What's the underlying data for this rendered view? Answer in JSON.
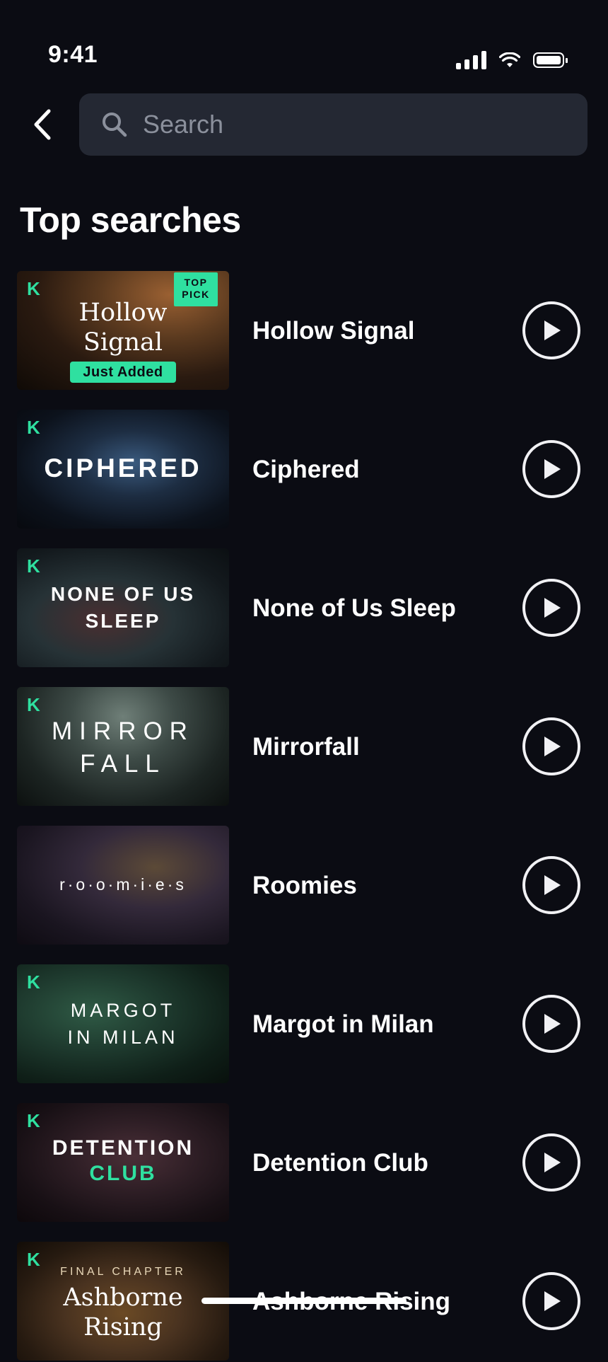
{
  "status_bar": {
    "time": "9:41",
    "icons": [
      "cellular-signal-icon",
      "wifi-icon",
      "battery-icon"
    ]
  },
  "header": {
    "back_icon": "chevron-left-icon",
    "search": {
      "placeholder": "Search",
      "value": "",
      "icon": "search-icon"
    }
  },
  "section": {
    "title": "Top searches"
  },
  "badges": {
    "k": "K",
    "top_pick": "TOP PICK",
    "just_added": "Just Added"
  },
  "colors": {
    "background": "#0b0c13",
    "accent": "#2fe0a0",
    "search_field": "#242833"
  },
  "results": [
    {
      "title": "Hollow Signal",
      "cover_lines": [
        "Hollow",
        "Signal"
      ]
    },
    {
      "title": "Ciphered",
      "cover_lines": [
        "CIPHERED"
      ]
    },
    {
      "title": "None of Us Sleep",
      "cover_lines": [
        "NONE OF US",
        "SLEEP"
      ]
    },
    {
      "title": "Mirrorfall",
      "cover_lines": [
        "MIRROR",
        "FALL"
      ]
    },
    {
      "title": "Roomies",
      "cover_lines": [
        "r·o·o·m·i·e·s"
      ]
    },
    {
      "title": "Margot in Milan",
      "cover_lines": [
        "MARGOT",
        "IN MILAN"
      ]
    },
    {
      "title": "Detention Club",
      "cover_lines": [
        "DETENTION",
        "CLUB"
      ]
    },
    {
      "title": "Ashborne Rising",
      "cover_lines": [
        "FINAL CHAPTER",
        "Ashborne",
        "Rising"
      ]
    }
  ]
}
